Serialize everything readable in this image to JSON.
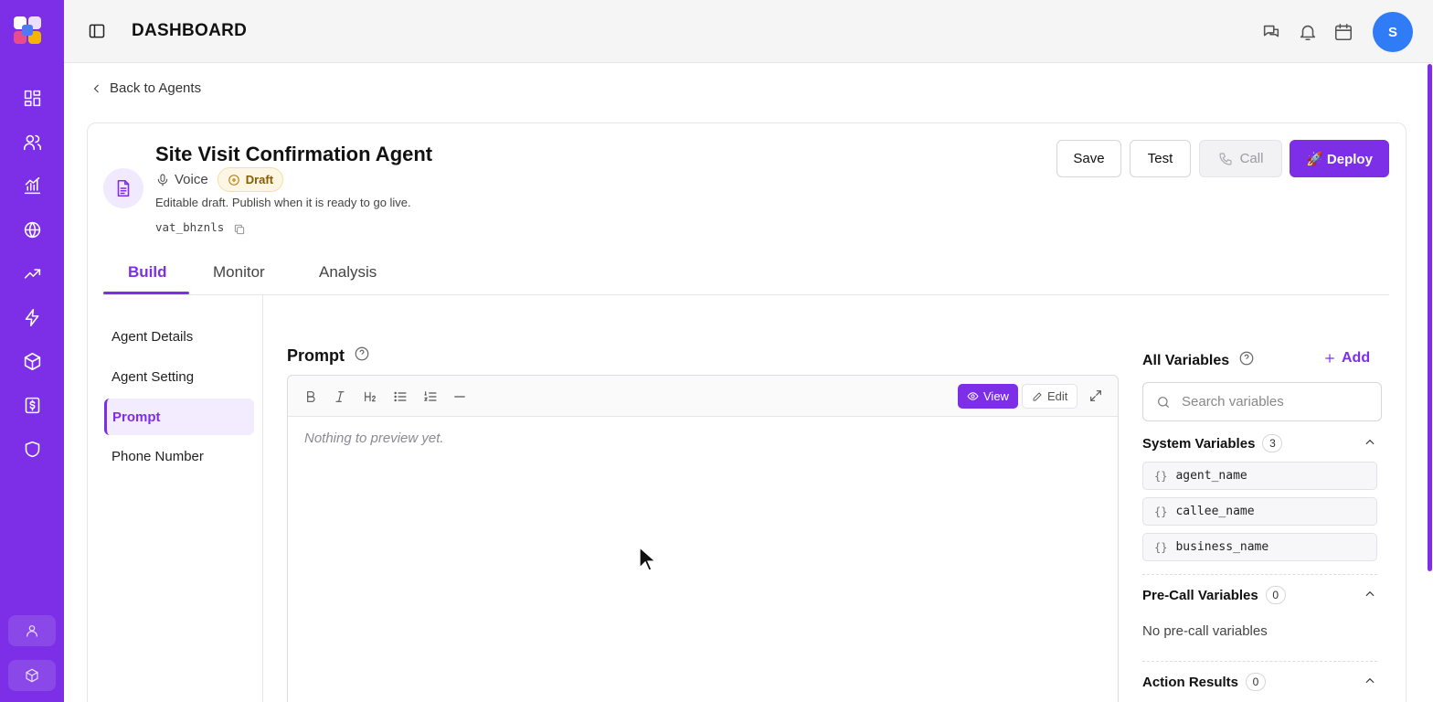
{
  "topbar": {
    "title": "DASHBOARD",
    "avatar_initial": "S"
  },
  "rail": {
    "nav_icons": [
      "grid-icon",
      "users-icon",
      "chart-icon",
      "globe-icon",
      "trending-icon",
      "zap-icon",
      "box-icon",
      "billing-icon",
      "shield-icon"
    ],
    "bottom_icons": [
      "user-icon",
      "package-icon"
    ]
  },
  "back_link": "Back to Agents",
  "agent": {
    "name": "Site Visit Confirmation Agent",
    "type": "Voice",
    "status": "Draft",
    "note": "Editable draft. Publish when it is ready to go live.",
    "id": "vat_bhznls"
  },
  "actions": {
    "save": "Save",
    "test": "Test",
    "call": "Call",
    "deploy": "🚀 Deploy"
  },
  "tabs": [
    "Build",
    "Monitor",
    "Analysis"
  ],
  "subnav": [
    "Agent Details",
    "Agent Setting",
    "Prompt",
    "Phone Number"
  ],
  "prompt": {
    "title": "Prompt",
    "view_label": "View",
    "edit_label": "Edit",
    "empty_text": "Nothing to preview yet.",
    "toolbar_tools": [
      "bold-icon",
      "italic-icon",
      "heading-icon",
      "bullet-list-icon",
      "numbered-list-icon",
      "divider-icon"
    ]
  },
  "variables": {
    "title": "All Variables",
    "add_label": "Add",
    "search_placeholder": "Search variables",
    "system": {
      "label": "System Variables",
      "count": "3",
      "items": [
        "agent_name",
        "callee_name",
        "business_name"
      ]
    },
    "precall": {
      "label": "Pre-Call Variables",
      "count": "0",
      "empty": "No pre-call variables"
    },
    "action_results": {
      "label": "Action Results",
      "count": "0"
    }
  },
  "colors": {
    "accent": "#7c2fe6",
    "avatar": "#2f7cf6",
    "draft_badge": "#fef6e4"
  }
}
